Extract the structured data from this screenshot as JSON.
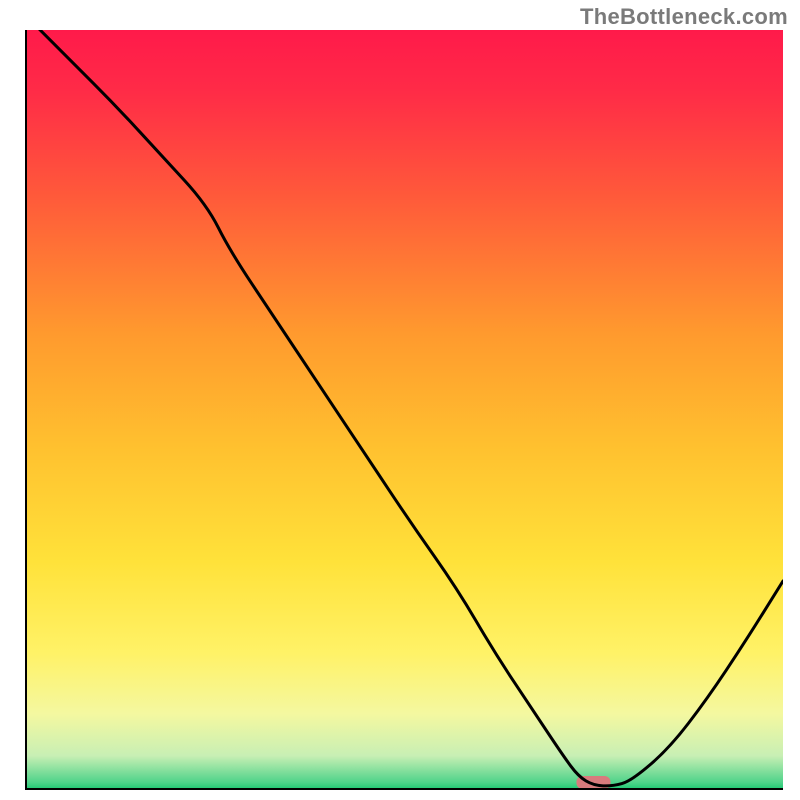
{
  "watermark_text": "TheBottleneck.com",
  "chart_data": {
    "type": "line",
    "title": "",
    "xlabel": "",
    "ylabel": "",
    "xlim": [
      0,
      100
    ],
    "ylim": [
      0,
      100
    ],
    "grid": false,
    "legend": false,
    "x": [
      0,
      6,
      12,
      18,
      24,
      27,
      33,
      39,
      45,
      51,
      57,
      62,
      67,
      71,
      73,
      75,
      77.5,
      80,
      85,
      90,
      95,
      100
    ],
    "values": [
      102,
      96,
      90,
      83.5,
      77,
      71,
      62,
      53,
      44,
      35,
      26.5,
      18,
      10.5,
      4.5,
      1.8,
      0.6,
      0.5,
      1.2,
      5.5,
      12,
      19.5,
      27.5
    ],
    "marker": {
      "x": 75,
      "width_pct": 4.5,
      "color": "#d87b7d"
    },
    "gradient_stops": [
      {
        "offset": 0,
        "color": "#ff1a4a"
      },
      {
        "offset": 0.08,
        "color": "#ff2b47"
      },
      {
        "offset": 0.22,
        "color": "#ff5a3a"
      },
      {
        "offset": 0.4,
        "color": "#ff9a2e"
      },
      {
        "offset": 0.55,
        "color": "#ffc12f"
      },
      {
        "offset": 0.7,
        "color": "#ffe23a"
      },
      {
        "offset": 0.82,
        "color": "#fff267"
      },
      {
        "offset": 0.9,
        "color": "#f4f8a0"
      },
      {
        "offset": 0.955,
        "color": "#c8efb4"
      },
      {
        "offset": 0.99,
        "color": "#4fd38a"
      },
      {
        "offset": 1.0,
        "color": "#18c76f"
      }
    ],
    "axes_color": "#000000"
  }
}
